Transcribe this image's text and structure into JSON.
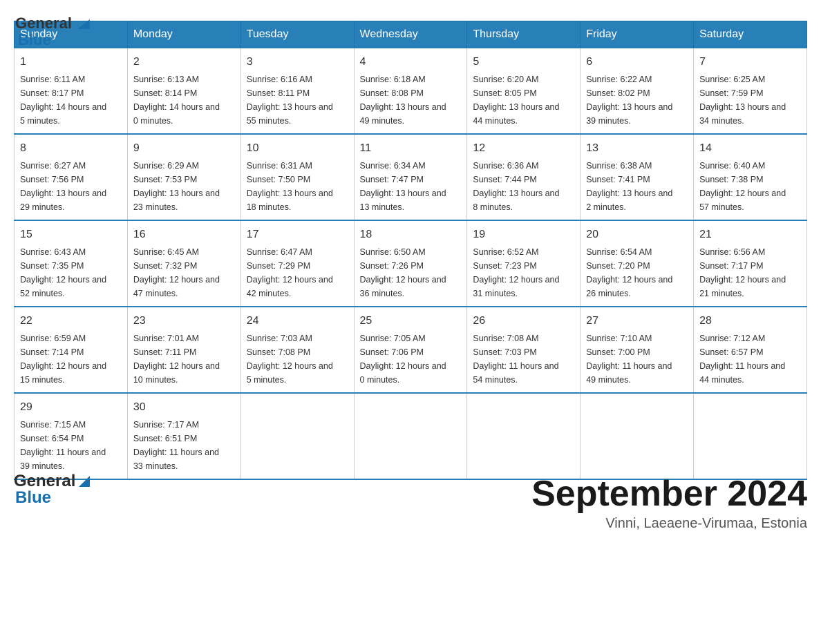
{
  "header": {
    "logo": {
      "text_general": "General",
      "text_blue": "Blue"
    },
    "title": "September 2024",
    "subtitle": "Vinni, Laeaene-Virumaa, Estonia"
  },
  "weekdays": [
    "Sunday",
    "Monday",
    "Tuesday",
    "Wednesday",
    "Thursday",
    "Friday",
    "Saturday"
  ],
  "weeks": [
    [
      {
        "day": "1",
        "sunrise": "6:11 AM",
        "sunset": "8:17 PM",
        "daylight": "14 hours and 5 minutes."
      },
      {
        "day": "2",
        "sunrise": "6:13 AM",
        "sunset": "8:14 PM",
        "daylight": "14 hours and 0 minutes."
      },
      {
        "day": "3",
        "sunrise": "6:16 AM",
        "sunset": "8:11 PM",
        "daylight": "13 hours and 55 minutes."
      },
      {
        "day": "4",
        "sunrise": "6:18 AM",
        "sunset": "8:08 PM",
        "daylight": "13 hours and 49 minutes."
      },
      {
        "day": "5",
        "sunrise": "6:20 AM",
        "sunset": "8:05 PM",
        "daylight": "13 hours and 44 minutes."
      },
      {
        "day": "6",
        "sunrise": "6:22 AM",
        "sunset": "8:02 PM",
        "daylight": "13 hours and 39 minutes."
      },
      {
        "day": "7",
        "sunrise": "6:25 AM",
        "sunset": "7:59 PM",
        "daylight": "13 hours and 34 minutes."
      }
    ],
    [
      {
        "day": "8",
        "sunrise": "6:27 AM",
        "sunset": "7:56 PM",
        "daylight": "13 hours and 29 minutes."
      },
      {
        "day": "9",
        "sunrise": "6:29 AM",
        "sunset": "7:53 PM",
        "daylight": "13 hours and 23 minutes."
      },
      {
        "day": "10",
        "sunrise": "6:31 AM",
        "sunset": "7:50 PM",
        "daylight": "13 hours and 18 minutes."
      },
      {
        "day": "11",
        "sunrise": "6:34 AM",
        "sunset": "7:47 PM",
        "daylight": "13 hours and 13 minutes."
      },
      {
        "day": "12",
        "sunrise": "6:36 AM",
        "sunset": "7:44 PM",
        "daylight": "13 hours and 8 minutes."
      },
      {
        "day": "13",
        "sunrise": "6:38 AM",
        "sunset": "7:41 PM",
        "daylight": "13 hours and 2 minutes."
      },
      {
        "day": "14",
        "sunrise": "6:40 AM",
        "sunset": "7:38 PM",
        "daylight": "12 hours and 57 minutes."
      }
    ],
    [
      {
        "day": "15",
        "sunrise": "6:43 AM",
        "sunset": "7:35 PM",
        "daylight": "12 hours and 52 minutes."
      },
      {
        "day": "16",
        "sunrise": "6:45 AM",
        "sunset": "7:32 PM",
        "daylight": "12 hours and 47 minutes."
      },
      {
        "day": "17",
        "sunrise": "6:47 AM",
        "sunset": "7:29 PM",
        "daylight": "12 hours and 42 minutes."
      },
      {
        "day": "18",
        "sunrise": "6:50 AM",
        "sunset": "7:26 PM",
        "daylight": "12 hours and 36 minutes."
      },
      {
        "day": "19",
        "sunrise": "6:52 AM",
        "sunset": "7:23 PM",
        "daylight": "12 hours and 31 minutes."
      },
      {
        "day": "20",
        "sunrise": "6:54 AM",
        "sunset": "7:20 PM",
        "daylight": "12 hours and 26 minutes."
      },
      {
        "day": "21",
        "sunrise": "6:56 AM",
        "sunset": "7:17 PM",
        "daylight": "12 hours and 21 minutes."
      }
    ],
    [
      {
        "day": "22",
        "sunrise": "6:59 AM",
        "sunset": "7:14 PM",
        "daylight": "12 hours and 15 minutes."
      },
      {
        "day": "23",
        "sunrise": "7:01 AM",
        "sunset": "7:11 PM",
        "daylight": "12 hours and 10 minutes."
      },
      {
        "day": "24",
        "sunrise": "7:03 AM",
        "sunset": "7:08 PM",
        "daylight": "12 hours and 5 minutes."
      },
      {
        "day": "25",
        "sunrise": "7:05 AM",
        "sunset": "7:06 PM",
        "daylight": "12 hours and 0 minutes."
      },
      {
        "day": "26",
        "sunrise": "7:08 AM",
        "sunset": "7:03 PM",
        "daylight": "11 hours and 54 minutes."
      },
      {
        "day": "27",
        "sunrise": "7:10 AM",
        "sunset": "7:00 PM",
        "daylight": "11 hours and 49 minutes."
      },
      {
        "day": "28",
        "sunrise": "7:12 AM",
        "sunset": "6:57 PM",
        "daylight": "11 hours and 44 minutes."
      }
    ],
    [
      {
        "day": "29",
        "sunrise": "7:15 AM",
        "sunset": "6:54 PM",
        "daylight": "11 hours and 39 minutes."
      },
      {
        "day": "30",
        "sunrise": "7:17 AM",
        "sunset": "6:51 PM",
        "daylight": "11 hours and 33 minutes."
      },
      null,
      null,
      null,
      null,
      null
    ]
  ]
}
